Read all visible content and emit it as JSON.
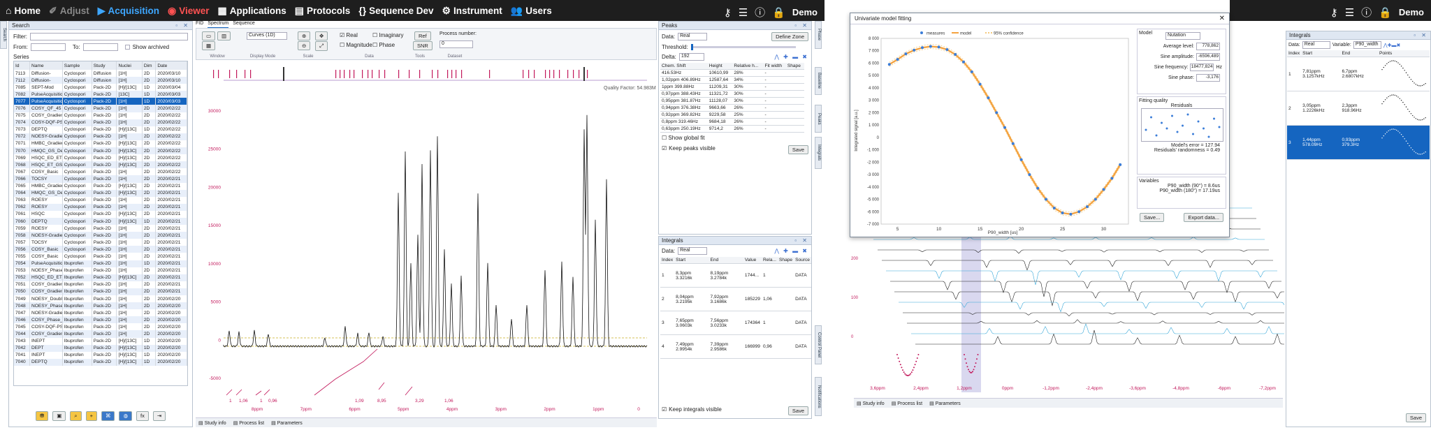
{
  "nav": {
    "home": "Home",
    "adjust": "Adjust",
    "acquisition": "Acquisition",
    "viewer": "Viewer",
    "applications": "Applications",
    "protocols": "Protocols",
    "sequence_dev": "Sequence Dev",
    "instrument": "Instrument",
    "users": "Users",
    "user": "Demo"
  },
  "search": {
    "title": "Search",
    "tab": "Search",
    "filter_label": "Filter:",
    "from_label": "From:",
    "to_label": "To:",
    "show_archived": "Show archived",
    "series_label": "Series",
    "columns": [
      "Id",
      "Name",
      "Sample",
      "Study",
      "Nuclei",
      "Dim",
      "Date"
    ],
    "rows": [
      [
        "7113",
        "Diffusion-",
        "Cyclospori",
        "Diffusion",
        "[1H]",
        "2D",
        "2020/03/10"
      ],
      [
        "7112",
        "Diffusion-",
        "Cyclospori",
        "Diffusion",
        "[1H]",
        "2D",
        "2020/03/10"
      ],
      [
        "7085",
        "SEPT-Mod",
        "Cyclospori",
        "Pack-2D",
        "[H]/[13C]",
        "1D",
        "2020/03/04"
      ],
      [
        "7082",
        "PulseAcquisition",
        "Cyclospori",
        "Pack-2D",
        "[13C]",
        "1D",
        "2020/03/03"
      ],
      [
        "7077",
        "PulseAcquisition",
        "Cyclospori",
        "Pack-2D",
        "[1H]",
        "1D",
        "2020/03/03"
      ],
      [
        "7076",
        "COSY_QF_45",
        "Cyclospori",
        "Pack-2D",
        "[1H]",
        "2D",
        "2020/02/22"
      ],
      [
        "7075",
        "COSY_Gradient",
        "Cyclospori",
        "Pack-2D",
        "[1H]",
        "2D",
        "2020/02/22"
      ],
      [
        "7074",
        "COSY-DQF-PS",
        "Cyclospori",
        "Pack-2D",
        "[1H]",
        "2D",
        "2020/02/22"
      ],
      [
        "7073",
        "DEPTQ",
        "Cyclospori",
        "Pack-2D",
        "[H]/[13C]",
        "1D",
        "2020/02/22"
      ],
      [
        "7072",
        "NOESY-Gradient",
        "Cyclospori",
        "Pack-2D",
        "[1H]",
        "2D",
        "2020/02/22"
      ],
      [
        "7071",
        "HMBC_Gradient",
        "Cyclospori",
        "Pack-2D",
        "[H]/[13C]",
        "2D",
        "2020/02/22"
      ],
      [
        "7070",
        "HMQC_GS_Decoup",
        "Cyclospori",
        "Pack-2D",
        "[H]/[13C]",
        "2D",
        "2020/02/22"
      ],
      [
        "7069",
        "HSQC_ED_ET_G",
        "Cyclospori",
        "Pack-2D",
        "[H]/[13C]",
        "2D",
        "2020/02/22"
      ],
      [
        "7068",
        "HSQC_ET_GS",
        "Cyclospori",
        "Pack-2D",
        "[H]/[13C]",
        "2D",
        "2020/02/22"
      ],
      [
        "7067",
        "COSY_Basic",
        "Cyclospori",
        "Pack-2D",
        "[1H]",
        "2D",
        "2020/02/22"
      ],
      [
        "7066",
        "TOCSY",
        "Cyclospori",
        "Pack-2D",
        "[1H]",
        "2D",
        "2020/02/21"
      ],
      [
        "7065",
        "HMBC_Gradient",
        "Cyclospori",
        "Pack-2D",
        "[H]/[13C]",
        "2D",
        "2020/02/21"
      ],
      [
        "7064",
        "HMQC_GS_Decoup",
        "Cyclospori",
        "Pack-2D",
        "[H]/[13C]",
        "2D",
        "2020/02/21"
      ],
      [
        "7063",
        "ROESY",
        "Cyclospori",
        "Pack-2D",
        "[1H]",
        "2D",
        "2020/02/21"
      ],
      [
        "7062",
        "ROESY",
        "Cyclospori",
        "Pack-2D",
        "[1H]",
        "2D",
        "2020/02/21"
      ],
      [
        "7061",
        "HSQC",
        "Cyclospori",
        "Pack-2D",
        "[H]/[13C]",
        "2D",
        "2020/02/21"
      ],
      [
        "7060",
        "DEPTQ",
        "Cyclospori",
        "Pack-2D",
        "[H]/[13C]",
        "1D",
        "2020/02/21"
      ],
      [
        "7059",
        "ROESY",
        "Cyclospori",
        "Pack-2D",
        "[1H]",
        "2D",
        "2020/02/21"
      ],
      [
        "7058",
        "NOESY-Gradient",
        "Cyclospori",
        "Pack-2D",
        "[1H]",
        "2D",
        "2020/02/21"
      ],
      [
        "7057",
        "TOCSY",
        "Cyclospori",
        "Pack-2D",
        "[1H]",
        "2D",
        "2020/02/21"
      ],
      [
        "7056",
        "COSY_Basic",
        "Cyclospori",
        "Pack-2D",
        "[1H]",
        "2D",
        "2020/02/21"
      ],
      [
        "7055",
        "COSY_Basic",
        "Cyclospori",
        "Pack-2D",
        "[1H]",
        "2D",
        "2020/02/21"
      ],
      [
        "7054",
        "PulseAcquisition",
        "Ibuprofen",
        "Pack-2D",
        "[1H]",
        "1D",
        "2020/02/21"
      ],
      [
        "7053",
        "NOESY_Phase_S",
        "Ibuprofen",
        "Pack-2D",
        "[1H]",
        "2D",
        "2020/02/21"
      ],
      [
        "7052",
        "HSQC_ED_ET_G",
        "Ibuprofen",
        "Pack-2D",
        "[H]/[13C]",
        "2D",
        "2020/02/21"
      ],
      [
        "7051",
        "COSY_Gradient",
        "Ibuprofen",
        "Pack-2D",
        "[1H]",
        "2D",
        "2020/02/21"
      ],
      [
        "7050",
        "COSY_Gradient",
        "Ibuprofen",
        "Pack-2D",
        "[1H]",
        "2D",
        "2020/02/21"
      ],
      [
        "7049",
        "NOESY_Double_S",
        "Ibuprofen",
        "Pack-2D",
        "[1H]",
        "2D",
        "2020/02/20"
      ],
      [
        "7048",
        "NOESY_Phase_S",
        "Ibuprofen",
        "Pack-2D",
        "[1H]",
        "2D",
        "2020/02/20"
      ],
      [
        "7047",
        "NOESY-Gradient",
        "Ibuprofen",
        "Pack-2D",
        "[1H]",
        "2D",
        "2020/02/20"
      ],
      [
        "7046",
        "COSY_Phase_S",
        "Ibuprofen",
        "Pack-2D",
        "[1H]",
        "2D",
        "2020/02/20"
      ],
      [
        "7045",
        "COSY-DQF-PS",
        "Ibuprofen",
        "Pack-2D",
        "[1H]",
        "2D",
        "2020/02/20"
      ],
      [
        "7044",
        "COSY_Gradient",
        "Ibuprofen",
        "Pack-2D",
        "[1H]",
        "2D",
        "2020/02/20"
      ],
      [
        "7043",
        "INEPT",
        "Ibuprofen",
        "Pack-2D",
        "[H]/[13C]",
        "1D",
        "2020/02/20"
      ],
      [
        "7042",
        "DEPT",
        "Ibuprofen",
        "Pack-2D",
        "[H]/[13C]",
        "1D",
        "2020/02/20"
      ],
      [
        "7041",
        "INEPT",
        "Ibuprofen",
        "Pack-2D",
        "[H]/[13C]",
        "1D",
        "2020/02/20"
      ],
      [
        "7040",
        "DEPTQ",
        "Ibuprofen",
        "Pack-2D",
        "[H]/[13C]",
        "1D",
        "2020/02/20"
      ]
    ]
  },
  "viewer": {
    "tabs": [
      "FID",
      "Spectrum",
      "Sequence"
    ],
    "groups": [
      "Window",
      "Display Mode",
      "Scale",
      "Data",
      "Tools",
      "Dataset"
    ],
    "display_mode": "Curves (1D)",
    "checks": [
      "Real",
      "Imaginary",
      "Magnitude",
      "Phase"
    ],
    "ref": "Ref",
    "snr": "SNR",
    "process_number_label": "Process number:",
    "process_number": "0",
    "quality": "Quality Factor: 54.983M",
    "yticks": [
      "30000",
      "25000",
      "20000",
      "15000",
      "10000",
      "5000",
      "0",
      "-5000"
    ],
    "xticks": [
      "8ppm",
      "7ppm",
      "6ppm",
      "5ppm",
      "4ppm",
      "3ppm",
      "2ppm",
      "1ppm",
      "0"
    ],
    "integral_labels": [
      "1",
      "1,06",
      "1",
      "0,96",
      "1,09",
      "8,95",
      "3,29",
      "1,06"
    ],
    "status": [
      "Study info",
      "Process list",
      "Parameters"
    ],
    "side_tabs": [
      "Phase",
      "Baseline",
      "Peaks",
      "Integrals"
    ],
    "side_tabs_low": [
      "Control Panel",
      "Notifications"
    ]
  },
  "peaks": {
    "title": "Peaks",
    "data_label": "Data:",
    "data_value": "Real",
    "define_zone": "Define Zone",
    "threshold_label": "Threshold:",
    "delta_label": "Delta:",
    "delta_value": "192",
    "columns": [
      "Chem. Shift",
      "Height",
      "Relative h...",
      "Fit width",
      "Shape"
    ],
    "rows": [
      [
        "416.53Hz",
        "10610,99",
        "28%",
        "-",
        ""
      ],
      [
        "1,02ppm 406.89Hz",
        "12587,64",
        "34%",
        "-",
        ""
      ],
      [
        "1ppm 399.88Hz",
        "11209,31",
        "30%",
        "-",
        ""
      ],
      [
        "0,97ppm 388.43Hz",
        "11321,72",
        "30%",
        "-",
        ""
      ],
      [
        "0,95ppm 381.87Hz",
        "11128,07",
        "30%",
        "-",
        ""
      ],
      [
        "0,94ppm 376.38Hz",
        "9663,66",
        "26%",
        "-",
        ""
      ],
      [
        "0,92ppm 369.82Hz",
        "9229,58",
        "25%",
        "-",
        ""
      ],
      [
        "0,8ppm 319.46Hz",
        "9684,18",
        "26%",
        "-",
        ""
      ],
      [
        "0,63ppm 250.19Hz",
        "9714,2",
        "26%",
        "-",
        ""
      ]
    ],
    "show_global_fit": "Show global fit",
    "keep_visible": "Keep peaks visible",
    "save": "Save"
  },
  "integrals_mid": {
    "title": "Integrals",
    "data_label": "Data:",
    "data_value": "Real",
    "columns": [
      "Index",
      "Start",
      "End",
      "Value",
      "Rela...",
      "Shape",
      "Source"
    ],
    "rows": [
      [
        "1",
        "8,3ppm 3.3216k",
        "8,19ppm 3.2784k",
        "1744...",
        "1",
        "",
        "DATA"
      ],
      [
        "2",
        "8,04ppm 3.2195k",
        "7,92ppm 3.1686k",
        "185229",
        "1,06",
        "",
        "DATA"
      ],
      [
        "3",
        "7,65ppm 3.0603k",
        "7,56ppm 3.0233k",
        "174364",
        "1",
        "",
        "DATA"
      ],
      [
        "4",
        "7,49ppm 2.9954k",
        "7,39ppm 2.9586k",
        "166999",
        "0,96",
        "",
        "DATA"
      ]
    ],
    "keep_visible": "Keep integrals visible",
    "save": "Save"
  },
  "fitting": {
    "title": "Univariate model fitting",
    "legend": [
      "measures",
      "model",
      "95% confidence"
    ],
    "ylabel": "Integrated signal [a.u.]",
    "xlabel": "P90_width [us]",
    "yticks": [
      "8 000",
      "7 000",
      "6 000",
      "5 000",
      "4 000",
      "3 000",
      "2 000",
      "1 000",
      "0",
      "-1 000",
      "-2 000",
      "-3 000",
      "-4 000",
      "-5 000",
      "-6 000",
      "-7 000"
    ],
    "xticks": [
      "5",
      "10",
      "15",
      "20",
      "25",
      "30"
    ],
    "model_label": "Model",
    "model_value": "Nutation",
    "params": [
      {
        "label": "Average level:",
        "value": "778,862",
        "unit": ""
      },
      {
        "label": "Sine amplitude:",
        "value": "-6596,489",
        "unit": ""
      },
      {
        "label": "Sine frequency:",
        "value": "18477,824",
        "unit": "Hz"
      },
      {
        "label": "Sine phase:",
        "value": "-3,176",
        "unit": ""
      }
    ],
    "quality_label": "Fitting quality",
    "residuals_label": "Residuals",
    "model_error": "Model's error  =  127.94",
    "randomness": "Residuals' randomness  =  0.49",
    "variables_label": "Variables",
    "var1": "P90_width (90°)  =  8.6us",
    "var2": "P90_width (180°)  =  17.19us",
    "save": "Save...",
    "export": "Export data...",
    "chart_data": {
      "type": "scatter",
      "x": [
        4,
        5,
        6,
        7,
        8,
        9,
        10,
        11,
        12,
        13,
        14,
        15,
        16,
        17,
        18,
        19,
        20,
        21,
        22,
        23,
        24,
        25,
        26,
        27,
        28,
        29,
        30,
        31,
        32
      ],
      "y": [
        5900,
        6300,
        6750,
        7050,
        7250,
        7350,
        7300,
        7100,
        6700,
        6100,
        5300,
        4300,
        3200,
        2000,
        800,
        -500,
        -1800,
        -3000,
        -4100,
        -5000,
        -5700,
        -6100,
        -6200,
        -6000,
        -5600,
        -5000,
        -4200,
        -3300,
        -2200
      ],
      "xlim": [
        3,
        33
      ],
      "ylim": [
        -7000,
        8000
      ]
    }
  },
  "array_view": {
    "yticks": [
      "200",
      "100",
      "0"
    ],
    "xticks": [
      "3,6ppm",
      "2,4ppm",
      "1,2ppm",
      "0ppm",
      "-1,2ppm",
      "-2,4ppm",
      "-3,6ppm",
      "-4,8ppm",
      "-6ppm",
      "-7,2ppm"
    ],
    "status": [
      "Study info",
      "Process list",
      "Parameters"
    ]
  },
  "integrals_right": {
    "title": "Integrals",
    "data_label": "Data:",
    "data_value": "Real",
    "variable_label": "Variable:",
    "variable_value": "P90_width",
    "columns": [
      "Index",
      "Start",
      "End",
      "Points"
    ],
    "rows": [
      [
        "1",
        "7,81ppm 3.1257kHz",
        "6,7ppm 2.6807kHz"
      ],
      [
        "2",
        "3,05ppm 1.2226kHz",
        "2,3ppm 918.96Hz"
      ],
      [
        "3",
        "1,44ppm 578.09Hz",
        "0,93ppm 379.3Hz"
      ]
    ],
    "save": "Save"
  },
  "right_nav": {
    "viewer": "Viewer",
    "user": "Demo"
  },
  "colors": {
    "accent": "#1565c0",
    "peak": "#c2185b",
    "model": "#f4a340"
  }
}
